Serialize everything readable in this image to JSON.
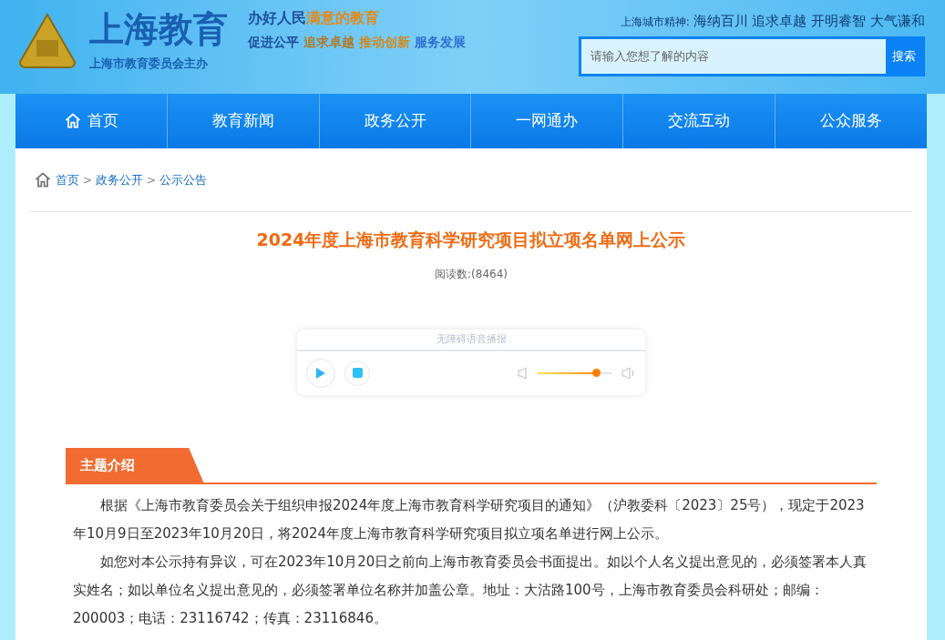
{
  "header": {
    "logo_title": "上海教育",
    "logo_subtitle": "上海市教育委员会主办",
    "slogan_lines": [
      [
        {
          "text": "办好人民",
          "color": "#1d4f9c"
        },
        {
          "text": "满意的教育",
          "color": "#e08a1c"
        }
      ],
      [
        {
          "text": "促进公平",
          "color": "#1d4f9c"
        },
        {
          "text": "追求卓越",
          "color": "#b07a2a"
        },
        {
          "text": "推动创新",
          "color": "#d08a20"
        },
        {
          "text": "服务发展",
          "color": "#2f6fd0"
        }
      ]
    ],
    "city_spirit_label": "上海城市精神:",
    "city_spirit": "海纳百川 追求卓越 开明睿智 大气谦和",
    "search": {
      "placeholder": "请输入您想了解的内容",
      "button": "搜索"
    }
  },
  "nav": [
    {
      "label": "首页",
      "kind": "home"
    },
    {
      "label": "教育新闻",
      "kind": "link"
    },
    {
      "label": "政务公开",
      "kind": "link"
    },
    {
      "label": "一网通办",
      "kind": "link"
    },
    {
      "label": "交流互动",
      "kind": "link"
    },
    {
      "label": "公众服务",
      "kind": "link"
    }
  ],
  "breadcrumb": [
    {
      "label": "首页"
    },
    {
      "label": "政务公开"
    },
    {
      "label": "公示公告"
    }
  ],
  "breadcrumb_separator": ">",
  "article": {
    "title": "2024年度上海市教育科学研究项目拟立项名单网上公示",
    "reads": "阅读数:(8464)",
    "player": {
      "title": "无障碍语音播报",
      "volume": {
        "level": 0.78
      }
    },
    "section_tab": "主题介绍",
    "paragraphs": [
      "根据《上海市教育委员会关于组织申报2024年度上海市教育科学研究项目的通知》（沪教委科〔2023〕25号），现定于2023年10月9日至2023年10月20日，将2024年度上海市教育科学研究项目拟立项名单进行网上公示。",
      "如您对本公示持有异议，可在2023年10月20日之前向上海市教育委员会书面提出。如以个人名义提出意见的，必须签署本人真实姓名；如以单位名义提出意见的，必须签署单位名称并加盖公章。地址：大沽路100号，上海市教育委员会科研处；邮编：200003；电话：23116742；传真：23116846。"
    ]
  }
}
